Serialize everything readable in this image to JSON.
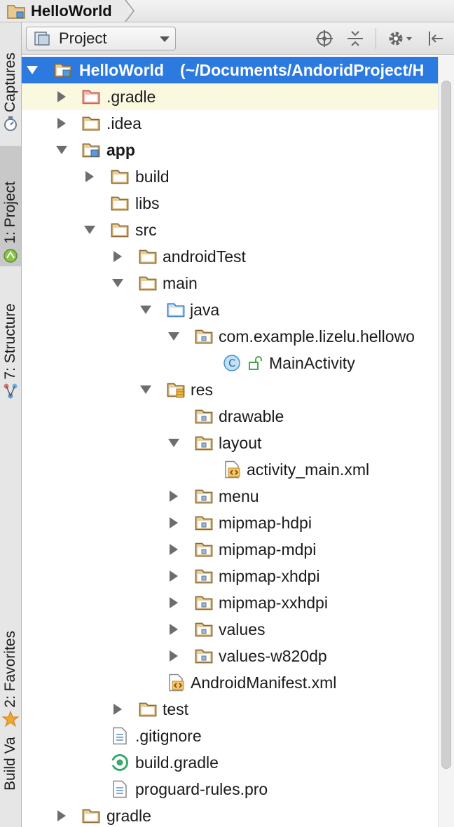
{
  "breadcrumb": {
    "project": "HelloWorld"
  },
  "toolwindow_tabs": [
    {
      "label": "Captures"
    },
    {
      "label": "1: Project"
    },
    {
      "label": "7: Structure"
    },
    {
      "label": "2: Favorites"
    },
    {
      "label": "Build Variants"
    }
  ],
  "panel": {
    "view_mode": "Project"
  },
  "tree": {
    "root_name": "HelloWorld",
    "root_path": "(~/Documents/AndoridProject/H",
    "gradle_dir": ".gradle",
    "idea_dir": ".idea",
    "app": "app",
    "build": "build",
    "libs": "libs",
    "src": "src",
    "androidTest": "androidTest",
    "main": "main",
    "java": "java",
    "package": "com.example.lizelu.hellowo",
    "main_activity": "MainActivity",
    "res": "res",
    "drawable": "drawable",
    "layout": "layout",
    "activity_main": "activity_main.xml",
    "menu": "menu",
    "mipmap_hdpi": "mipmap-hdpi",
    "mipmap_mdpi": "mipmap-mdpi",
    "mipmap_xhdpi": "mipmap-xhdpi",
    "mipmap_xxhdpi": "mipmap-xxhdpi",
    "values": "values",
    "values_w820dp": "values-w820dp",
    "manifest": "AndroidManifest.xml",
    "test": "test",
    "gitignore": ".gitignore",
    "build_gradle": "build.gradle",
    "proguard": "proguard-rules.pro",
    "gradle": "gradle"
  }
}
